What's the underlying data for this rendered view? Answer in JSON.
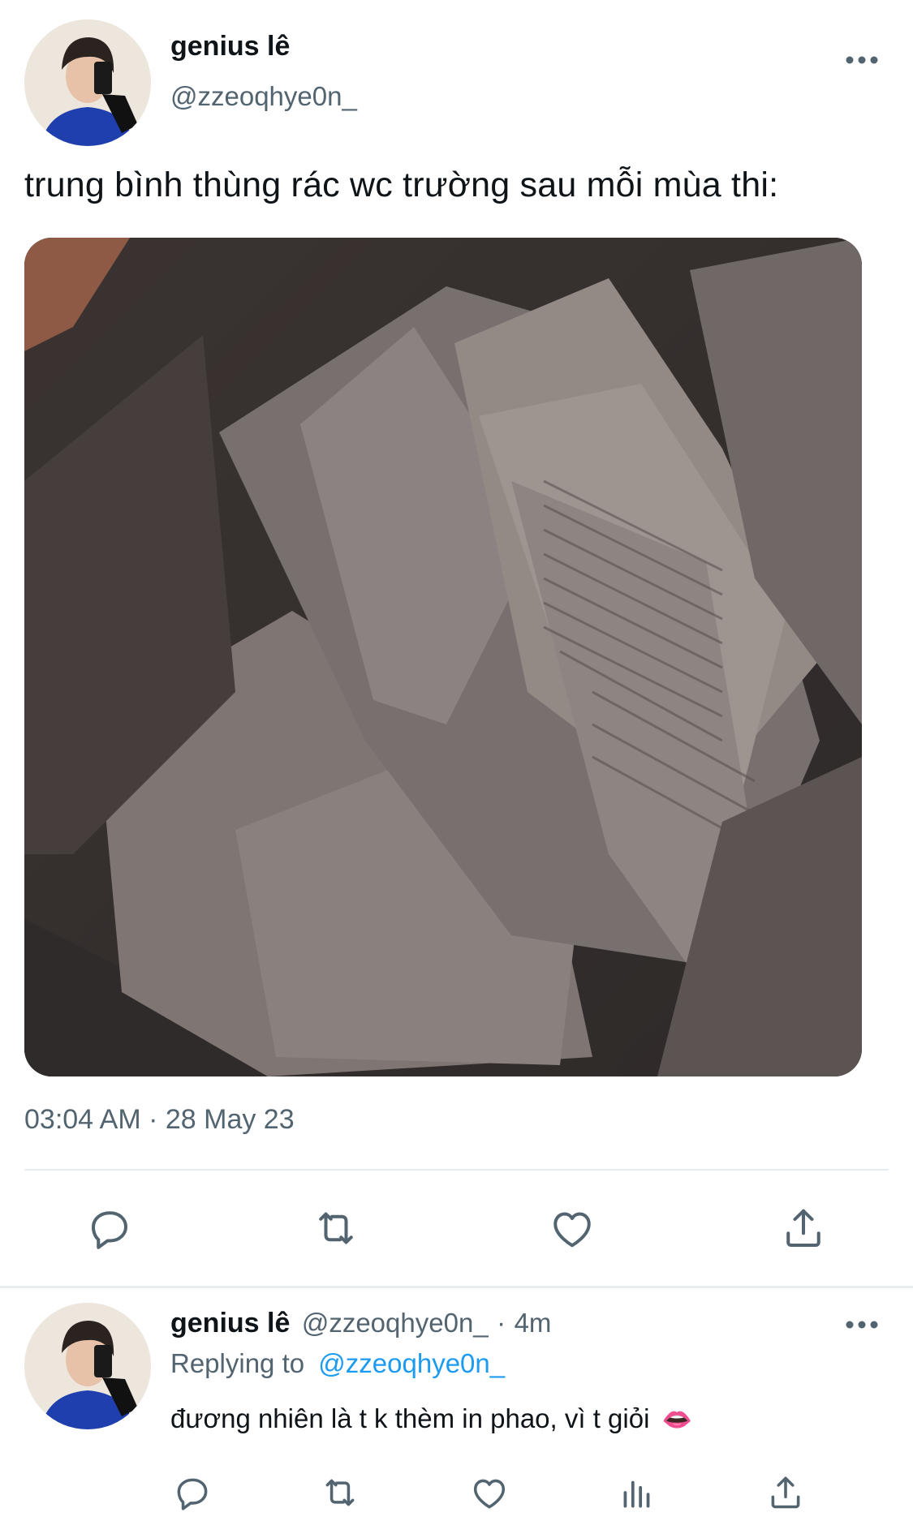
{
  "main_tweet": {
    "author_name": "genius lê",
    "author_handle": "@zzeoqhye0n_",
    "text": "trung bình thùng rác wc trường sau mỗi mùa thi:",
    "timestamp": "03:04 AM · 28 May 23",
    "avatar_icon": "profile-photo",
    "more_icon": "more-horizontal-icon",
    "media_icon": "photo-papers-in-trash-bin"
  },
  "main_actions": [
    {
      "icon": "reply-icon"
    },
    {
      "icon": "retweet-icon"
    },
    {
      "icon": "like-icon"
    },
    {
      "icon": "share-icon"
    }
  ],
  "reply_tweet": {
    "author_name": "genius lê",
    "author_handle": "@zzeoqhye0n_",
    "separator": "·",
    "time_ago": "4m",
    "replying_label": "Replying to",
    "replying_handle": "@zzeoqhye0n_",
    "text": "đương nhiên là t k thèm in phao, vì t giỏi",
    "emoji": "👄",
    "avatar_icon": "profile-photo",
    "more_icon": "more-horizontal-icon"
  },
  "reply_actions": [
    {
      "icon": "reply-icon"
    },
    {
      "icon": "retweet-icon"
    },
    {
      "icon": "like-icon"
    },
    {
      "icon": "analytics-icon"
    },
    {
      "icon": "share-icon"
    }
  ],
  "colors": {
    "text": "#0f1419",
    "muted": "#536471",
    "link": "#1d9bf0",
    "divider": "#e6ecf0"
  }
}
